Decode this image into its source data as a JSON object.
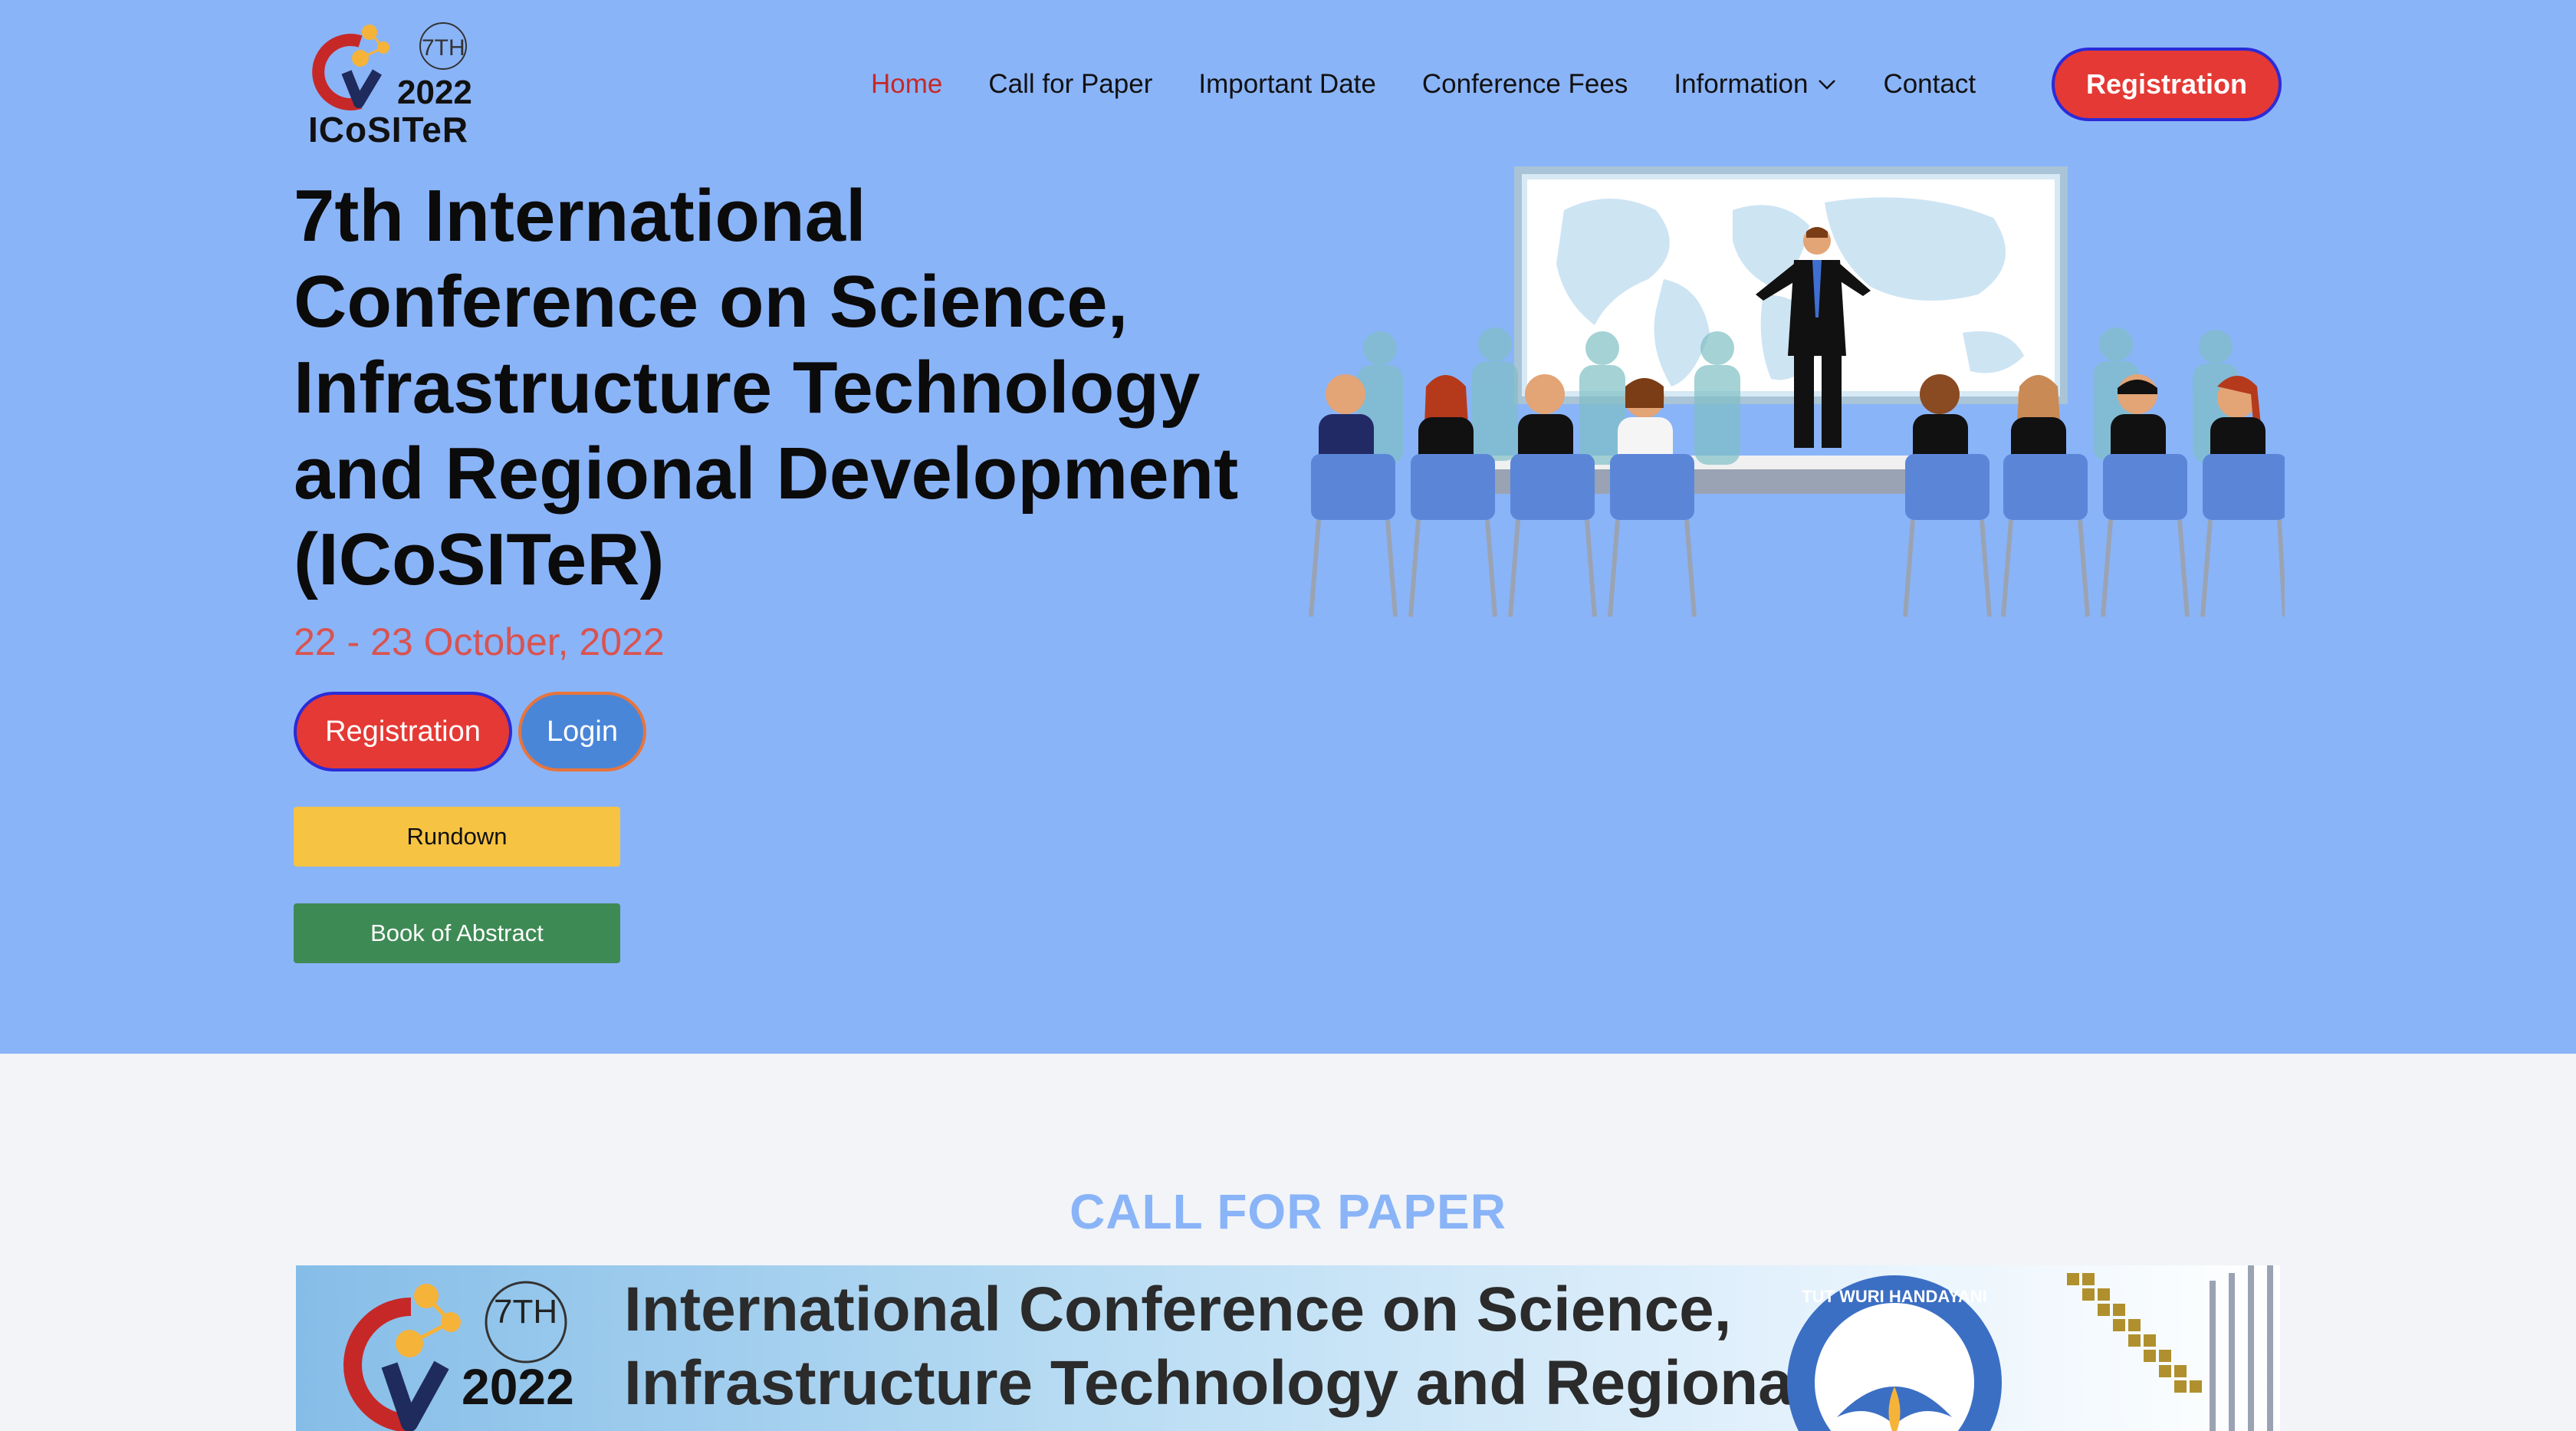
{
  "header": {
    "logo": {
      "superscript": "7TH",
      "year": "2022",
      "name": "ICoSITeR"
    },
    "nav": [
      {
        "label": "Home",
        "active": true
      },
      {
        "label": "Call for Paper"
      },
      {
        "label": "Important Date"
      },
      {
        "label": "Conference Fees"
      },
      {
        "label": "Information",
        "dropdown": true
      },
      {
        "label": "Contact"
      }
    ],
    "registration_button": "Registration"
  },
  "hero": {
    "title": "7th International Conference on Science, Infrastructure Technology and Regional Development (ICoSITeR)",
    "date": "22 - 23 October, 2022",
    "registration_button": "Registration",
    "login_button": "Login",
    "rundown_button": "Rundown",
    "book_of_abstract_button": "Book of Abstract"
  },
  "call_for_paper": {
    "heading": "CALL FOR PAPER",
    "banner": {
      "superscript": "7TH",
      "year": "2022",
      "text": "International Conference on Science, Infrastructure Technology and Regional Development",
      "emblem_text": "TUT WURI HANDAYANI"
    }
  },
  "colors": {
    "hero_bg": "#8ab4f8",
    "accent_red": "#e53935",
    "nav_active": "#c62828",
    "button_yellow": "#f6c343",
    "button_green": "#3e8a54"
  }
}
